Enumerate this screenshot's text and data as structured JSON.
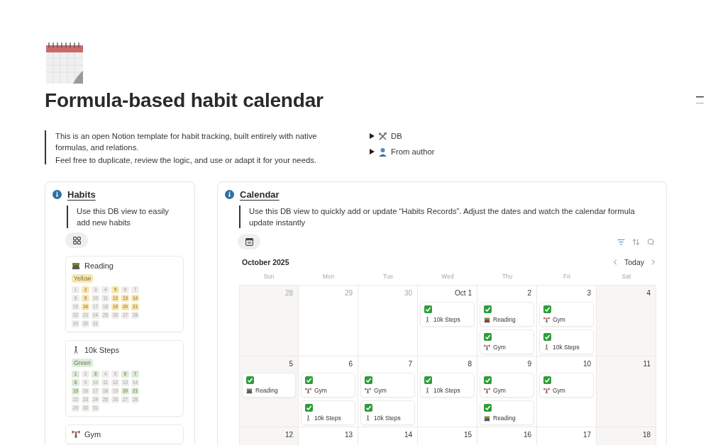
{
  "page": {
    "title": "Formula-based habit calendar"
  },
  "intro": {
    "paragraphs": [
      "This is an open Notion template for habit tracking, built entirely with native formulas, and relations.",
      "Feel free to duplicate, review the logic, and use or adapt it for your needs."
    ]
  },
  "toggles": [
    {
      "kind": "tools",
      "label": "DB",
      "expanded": false
    },
    {
      "kind": "person",
      "label": "From author",
      "expanded": false
    }
  ],
  "habits": {
    "title": "Habits",
    "note": "Use this DB view to easily add new habits",
    "items": [
      {
        "name": "Reading",
        "kind": "reading",
        "tag": "Yellow",
        "color": "#f8e7b4",
        "days": [
          {
            "label": "1",
            "done": false
          },
          {
            "label": "2",
            "done": true
          },
          {
            "label": "3",
            "done": false
          },
          {
            "label": "4",
            "done": false
          },
          {
            "label": "5",
            "done": true
          },
          {
            "label": "6",
            "done": false
          },
          {
            "label": "7",
            "done": false
          },
          {
            "label": "8",
            "done": false
          },
          {
            "label": "9",
            "done": true
          },
          {
            "label": "10",
            "done": false
          },
          {
            "label": "11",
            "done": false
          },
          {
            "label": "12",
            "done": true
          },
          {
            "label": "13",
            "done": true
          },
          {
            "label": "14",
            "done": true
          },
          {
            "label": "15",
            "done": false
          },
          {
            "label": "16",
            "done": true
          },
          {
            "label": "17",
            "done": false
          },
          {
            "label": "18",
            "done": false
          },
          {
            "label": "19",
            "done": true
          },
          {
            "label": "20",
            "done": true
          },
          {
            "label": "21",
            "done": true
          },
          {
            "label": "22",
            "done": false
          },
          {
            "label": "23",
            "done": false
          },
          {
            "label": "24",
            "done": false
          },
          {
            "label": "25",
            "done": false
          },
          {
            "label": "26",
            "done": false
          },
          {
            "label": "27",
            "done": false
          },
          {
            "label": "28",
            "done": false
          },
          {
            "label": "29",
            "done": false
          },
          {
            "label": "30",
            "done": false
          },
          {
            "label": "31",
            "done": false
          }
        ]
      },
      {
        "name": "10k Steps",
        "kind": "walking",
        "tag": "Green",
        "color": "#dbeddb",
        "days": [
          {
            "label": "1",
            "done": true
          },
          {
            "label": "2",
            "done": false
          },
          {
            "label": "3",
            "done": true
          },
          {
            "label": "4",
            "done": false
          },
          {
            "label": "5",
            "done": false
          },
          {
            "label": "6",
            "done": true
          },
          {
            "label": "7",
            "done": true
          },
          {
            "label": "8",
            "done": true
          },
          {
            "label": "9",
            "done": false
          },
          {
            "label": "10",
            "done": false
          },
          {
            "label": "11",
            "done": false
          },
          {
            "label": "12",
            "done": false
          },
          {
            "label": "13",
            "done": false
          },
          {
            "label": "14",
            "done": false
          },
          {
            "label": "15",
            "done": true
          },
          {
            "label": "16",
            "done": false
          },
          {
            "label": "17",
            "done": false
          },
          {
            "label": "18",
            "done": false
          },
          {
            "label": "19",
            "done": false
          },
          {
            "label": "20",
            "done": true
          },
          {
            "label": "21",
            "done": true
          },
          {
            "label": "22",
            "done": false
          },
          {
            "label": "23",
            "done": false
          },
          {
            "label": "24",
            "done": false
          },
          {
            "label": "25",
            "done": false
          },
          {
            "label": "26",
            "done": false
          },
          {
            "label": "27",
            "done": false
          },
          {
            "label": "28",
            "done": false
          },
          {
            "label": "29",
            "done": false
          },
          {
            "label": "30",
            "done": false
          },
          {
            "label": "31",
            "done": false
          }
        ]
      },
      {
        "name": "Gym",
        "kind": "gym"
      }
    ]
  },
  "calendar": {
    "title": "Calendar",
    "note": "Use this DB view to quickly add or update “Habits Records”. Adjust the dates and watch the calendar formula update instantly",
    "month": "October 2025",
    "today": "Today",
    "weekdays": [
      "Sun",
      "Mon",
      "Tue",
      "Wed",
      "Thu",
      "Fri",
      "Sat"
    ],
    "weeks": [
      [
        {
          "label": "28",
          "outside": true
        },
        {
          "label": "29",
          "outside": true
        },
        {
          "label": "30",
          "outside": true
        },
        {
          "label": "Oct 1",
          "outside": false,
          "entries": [
            {
              "kind": "walking",
              "habit": "10k Steps",
              "done": true
            }
          ]
        },
        {
          "label": "2",
          "outside": false,
          "entries": [
            {
              "kind": "reading",
              "habit": "Reading",
              "done": true
            },
            {
              "kind": "gym",
              "habit": "Gym",
              "done": true
            }
          ]
        },
        {
          "label": "3",
          "outside": false,
          "entries": [
            {
              "kind": "gym",
              "habit": "Gym",
              "done": true
            },
            {
              "kind": "walking",
              "habit": "10k Steps",
              "done": true
            }
          ]
        },
        {
          "label": "4",
          "outside": false
        }
      ],
      [
        {
          "label": "5",
          "outside": false,
          "entries": [
            {
              "kind": "reading",
              "habit": "Reading",
              "done": true
            }
          ]
        },
        {
          "label": "6",
          "outside": false,
          "entries": [
            {
              "kind": "gym",
              "habit": "Gym",
              "done": true
            },
            {
              "kind": "walking",
              "habit": "10k Steps",
              "done": true
            }
          ]
        },
        {
          "label": "7",
          "outside": false,
          "entries": [
            {
              "kind": "gym",
              "habit": "Gym",
              "done": true
            },
            {
              "kind": "walking",
              "habit": "10k Steps",
              "done": true
            }
          ]
        },
        {
          "label": "8",
          "outside": false,
          "entries": [
            {
              "kind": "walking",
              "habit": "10k Steps",
              "done": true
            }
          ]
        },
        {
          "label": "9",
          "outside": false,
          "entries": [
            {
              "kind": "gym",
              "habit": "Gym",
              "done": true
            },
            {
              "kind": "reading",
              "habit": "Reading",
              "done": true
            }
          ]
        },
        {
          "label": "10",
          "outside": false,
          "entries": [
            {
              "kind": "gym",
              "habit": "Gym",
              "done": true
            }
          ]
        },
        {
          "label": "11",
          "outside": false
        }
      ],
      [
        {
          "label": "12",
          "outside": false
        },
        {
          "label": "13",
          "outside": false
        },
        {
          "label": "14",
          "outside": false
        },
        {
          "label": "15",
          "outside": false
        },
        {
          "label": "16",
          "outside": false
        },
        {
          "label": "17",
          "outside": false
        },
        {
          "label": "18",
          "outside": false
        }
      ]
    ]
  }
}
